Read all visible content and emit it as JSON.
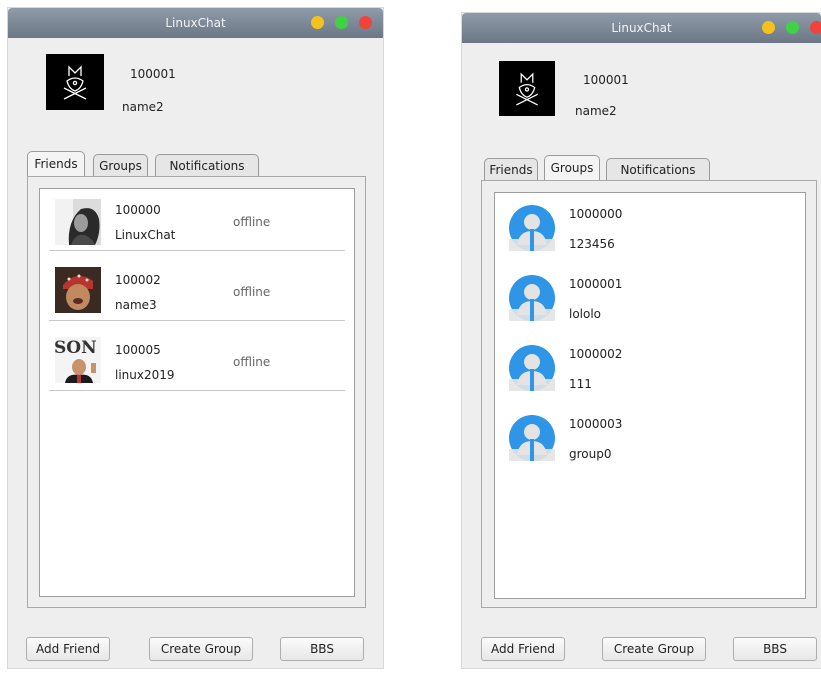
{
  "colors": {
    "light_yellow": "#f5c21c",
    "light_green": "#3fd245",
    "light_red": "#f2433b",
    "group_icon_blue": "#2f95e7"
  },
  "window_left": {
    "title": "LinuxChat",
    "user": {
      "id": "100001",
      "name": "name2",
      "avatar_icon": "cat-face-icon"
    },
    "tabs": [
      {
        "label": "Friends",
        "active": true
      },
      {
        "label": "Groups",
        "active": false
      },
      {
        "label": "Notifications",
        "active": false
      }
    ],
    "friends": [
      {
        "id": "100000",
        "name": "LinuxChat",
        "status": "offline",
        "avatar_icon": "portrait-photo"
      },
      {
        "id": "100002",
        "name": "name3",
        "status": "offline",
        "avatar_icon": "portrait-photo"
      },
      {
        "id": "100005",
        "name": "linux2019",
        "status": "offline",
        "avatar_icon": "portrait-photo"
      }
    ],
    "buttons": {
      "add_friend": "Add Friend",
      "create_group": "Create Group",
      "bbs": "BBS"
    },
    "logo_text": "SON"
  },
  "window_right": {
    "title": "LinuxChat",
    "user": {
      "id": "100001",
      "name": "name2",
      "avatar_icon": "cat-face-icon"
    },
    "tabs": [
      {
        "label": "Friends",
        "active": false
      },
      {
        "label": "Groups",
        "active": true
      },
      {
        "label": "Notifications",
        "active": false
      }
    ],
    "groups": [
      {
        "id": "1000000",
        "name": "123456",
        "icon": "group-avatar-icon"
      },
      {
        "id": "1000001",
        "name": "lololo",
        "icon": "group-avatar-icon"
      },
      {
        "id": "1000002",
        "name": "111",
        "icon": "group-avatar-icon"
      },
      {
        "id": "1000003",
        "name": "group0",
        "icon": "group-avatar-icon"
      }
    ],
    "buttons": {
      "add_friend": "Add Friend",
      "create_group": "Create Group",
      "bbs": "BBS"
    }
  }
}
